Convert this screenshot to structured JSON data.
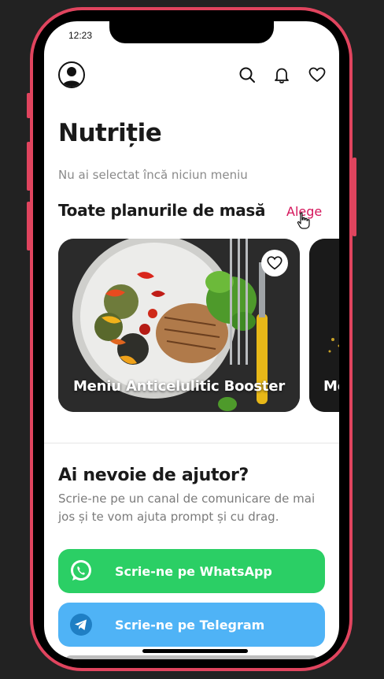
{
  "status": {
    "time": "12:23"
  },
  "header": {
    "avatar_icon": "user-avatar-icon",
    "search_icon": "search-icon",
    "notifications_icon": "bell-icon",
    "favorites_icon": "heart-icon"
  },
  "page": {
    "title": "Nutriție",
    "subtitle": "Nu ai selectat încă niciun meniu"
  },
  "meal_plans": {
    "section_title": "Toate planurile de masă",
    "choose_label": "Alege",
    "cards": [
      {
        "title": "Meniu Anticelulitic Booster",
        "favorite_icon": "heart-outline-icon"
      },
      {
        "title": "Me"
      }
    ]
  },
  "help": {
    "title": "Ai nevoie de ajutor?",
    "text": "Scrie-ne pe un canal de comunicare de mai jos și te vom ajuta prompt și cu drag.",
    "whatsapp_label": "Scrie-ne pe WhatsApp",
    "telegram_label": "Scrie-ne pe Telegram"
  },
  "colors": {
    "frame": "#e0445e",
    "accent_link": "#d4145a",
    "whatsapp": "#2bcf65",
    "telegram": "#4fb3f6"
  }
}
